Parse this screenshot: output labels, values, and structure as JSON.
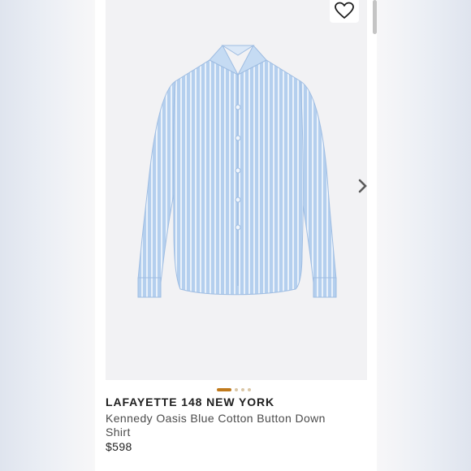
{
  "product": {
    "brand": "LAFAYETTE 148 NEW YORK",
    "name": "Kennedy Oasis Blue Cotton Button Down Shirt",
    "price": "$598"
  },
  "gallery": {
    "image_count": 4,
    "active_index": 0,
    "next_icon": "chevron-right-icon",
    "favorite_icon": "heart-outline-icon"
  },
  "colors": {
    "accent": "#c07a1c",
    "dot_inactive": "#d9c6a6",
    "shirt_blue": "#a9c6ea"
  }
}
